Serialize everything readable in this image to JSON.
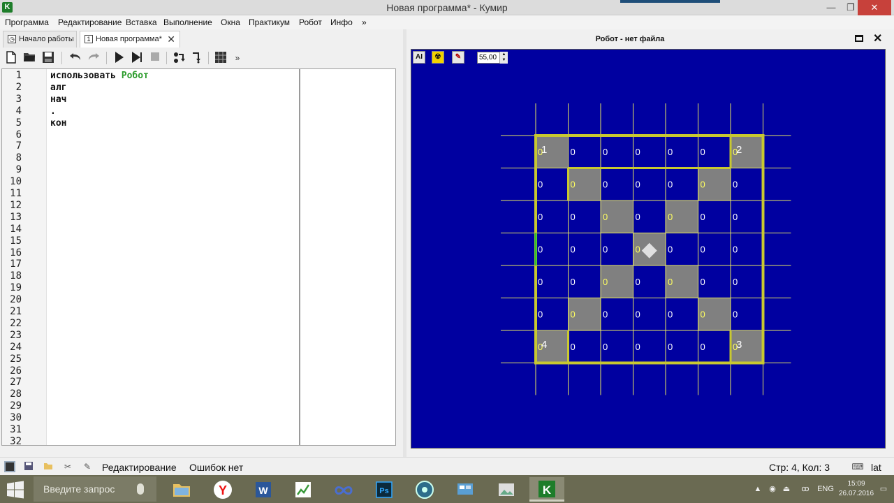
{
  "window": {
    "icon_letter": "K",
    "title": "Новая программа* - Кумир",
    "minimize": "—",
    "maximize": "❐",
    "close": "✕"
  },
  "menu": [
    "Программа",
    "Редактирование",
    "Вставка",
    "Выполнение",
    "Окна",
    "Практикум",
    "Робот",
    "Инфо",
    "»"
  ],
  "tabs": [
    {
      "label": "Начало работы",
      "icon": "clock-icon"
    },
    {
      "label": "Новая программа*",
      "icon": "number-one-icon",
      "icon_text": "1",
      "close": "✕"
    }
  ],
  "toolbar": {
    "overflow": "»"
  },
  "editor": {
    "line_numbers": [
      "1",
      "2",
      "3",
      "4",
      "5",
      "6",
      "7",
      "8",
      "9",
      "10",
      "11",
      "12",
      "13",
      "14",
      "15",
      "16",
      "17",
      "18",
      "19",
      "20",
      "21",
      "22",
      "23",
      "24",
      "25",
      "26",
      "27",
      "28",
      "29",
      "30",
      "31",
      "32"
    ],
    "code": [
      {
        "kw": "использовать",
        "arg": "Робот"
      },
      {
        "kw": "алг"
      },
      {
        "kw": "нач"
      },
      {
        "kw": "."
      },
      {
        "kw": "кон"
      }
    ]
  },
  "robot": {
    "title": "Робот - нет файла",
    "tools": [
      "AI",
      "☢",
      "✎"
    ],
    "zoom": "55,00",
    "grid": {
      "cols": 7,
      "rows": 7,
      "shaded": [
        [
          0,
          0
        ],
        [
          0,
          6
        ],
        [
          1,
          1
        ],
        [
          1,
          5
        ],
        [
          2,
          2
        ],
        [
          2,
          4
        ],
        [
          3,
          3
        ],
        [
          4,
          2
        ],
        [
          4,
          4
        ],
        [
          5,
          1
        ],
        [
          5,
          5
        ],
        [
          6,
          0
        ],
        [
          6,
          6
        ]
      ],
      "cell_value": "0",
      "corner_labels": [
        {
          "row": 0,
          "col": 0,
          "text": "1"
        },
        {
          "row": 0,
          "col": 6,
          "text": "2"
        },
        {
          "row": 6,
          "col": 6,
          "text": "3"
        },
        {
          "row": 6,
          "col": 0,
          "text": "4"
        }
      ],
      "robot_cell": [
        3,
        3
      ],
      "colors": {
        "background": "#0000a0",
        "line": "#e8e860",
        "wall": "#c8c830",
        "shade": "#808080",
        "text": "#ffffff",
        "text_shaded": "#ffff60",
        "robot": "#e0e0e0"
      }
    }
  },
  "status": {
    "mode": "Редактирование",
    "errors": "Ошибок нет",
    "position": "Стр: 4, Кол: 3",
    "layout": "lat"
  },
  "taskbar": {
    "search_placeholder": "Введите запрос",
    "apps": [
      "file-explorer-icon",
      "yandex-browser-icon",
      "word-icon",
      "chart-app-icon",
      "infinity-app-icon",
      "photoshop-icon",
      "media-icon",
      "control-panel-icon",
      "photo-viewer-icon",
      "kumir-icon"
    ],
    "app_labels": {
      "word": "W",
      "photoshop": "Ps",
      "yandex": "Y",
      "kumir": "K"
    },
    "tray_lang": "ENG",
    "time": "15:09",
    "date": "26.07.2016"
  }
}
